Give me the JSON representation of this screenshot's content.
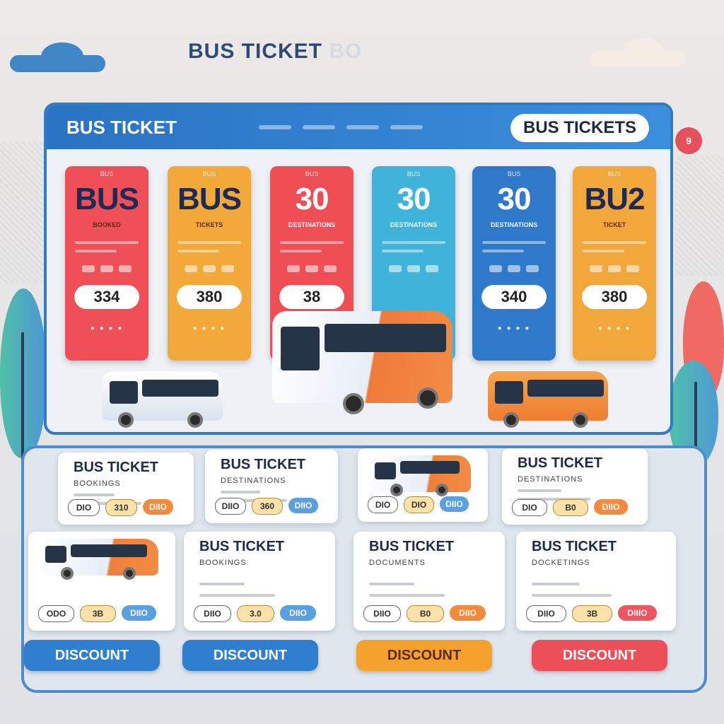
{
  "page": {
    "heading": "BUS TICKET",
    "heading_faded": "BO"
  },
  "window": {
    "title": "BUS TICKET",
    "pill": "BUS TICKETS",
    "badge": "9"
  },
  "tickets": [
    {
      "top": "BUS",
      "big": "BUS",
      "sub": "BOOKED",
      "price": "334",
      "color": "#ef5057",
      "big_color": "#1d2a55"
    },
    {
      "top": "BUS",
      "big": "BUS",
      "sub": "TICKETS",
      "price": "380",
      "color": "#f2a93a",
      "big_color": "#1d2a55"
    },
    {
      "top": "BUS",
      "big": "30",
      "sub": "DESTINATIONS",
      "price": "38",
      "color": "#ee4e54",
      "big_color": "#ffffff"
    },
    {
      "top": "BUS",
      "big": "30",
      "sub": "DESTINATIONS",
      "price": "",
      "color": "#3fb3da",
      "big_color": "#ffffff"
    },
    {
      "top": "BUS",
      "big": "30",
      "sub": "DESTINATIONS",
      "price": "340",
      "color": "#2e79c9",
      "big_color": "#ffffff"
    },
    {
      "top": "BUS",
      "big": "BU2",
      "sub": "TICKET",
      "price": "380",
      "color": "#f2a73a",
      "big_color": "#1d2a55"
    }
  ],
  "cards_top": [
    {
      "title": "BUS TICKET",
      "sub": "BOOKINGS",
      "pills": [
        "DIO",
        "310",
        "DIIO"
      ]
    },
    {
      "title": "BUS TICKET",
      "sub": "DESTINATIONS",
      "pills": [
        "DIIO",
        "360",
        "DIIO"
      ]
    },
    {
      "title": "",
      "sub": "",
      "pills": [
        "DIO",
        "DIO",
        "DIIO"
      ]
    },
    {
      "title": "BUS TICKET",
      "sub": "DESTINATIONS",
      "pills": [
        "DIO",
        "B0",
        "DIIO"
      ]
    }
  ],
  "cards_bottom": [
    {
      "title": "",
      "sub": "",
      "pills": [
        "ODO",
        "3B",
        "DIIO"
      ]
    },
    {
      "title": "BUS TICKET",
      "sub": "BOOKINGS",
      "pills": [
        "DIIO",
        "3.0",
        "DIIO"
      ]
    },
    {
      "title": "BUS TICKET",
      "sub": "DOCUMENTS",
      "pills": [
        "DIIO",
        "B0",
        "DIIO"
      ]
    },
    {
      "title": "BUS TICKET",
      "sub": "DOCKETINGS",
      "pills": [
        "DIIO",
        "3B",
        "DIIIO"
      ]
    }
  ],
  "discount_buttons": [
    {
      "label": "DISCOUNT",
      "color": "#2f7fd0"
    },
    {
      "label": "DISCOUNT",
      "color": "#2f7fd0"
    },
    {
      "label": "DISCOUNT",
      "color": "#f5a12e"
    },
    {
      "label": "DISCOUNT",
      "color": "#ec4f58"
    }
  ]
}
